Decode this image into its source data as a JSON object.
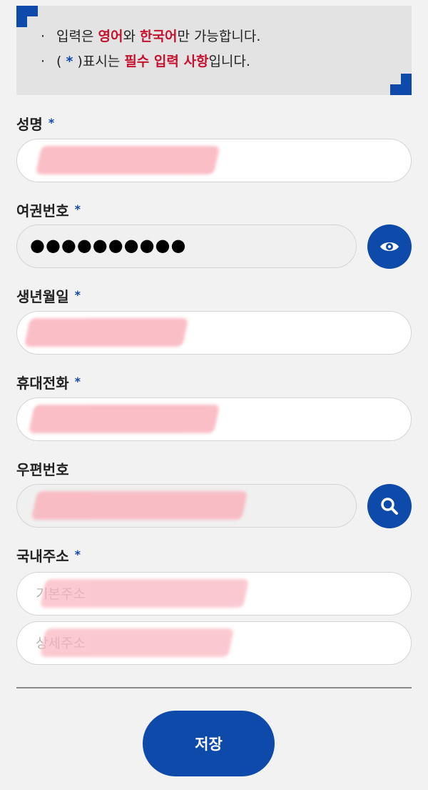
{
  "notice": {
    "bullet": "·",
    "line1": {
      "pre": "입력은 ",
      "hl1": "영어",
      "mid": "와 ",
      "hl2": "한국어",
      "post": "만 가능합니다."
    },
    "line2": {
      "open": "( ",
      "star": "*",
      "close": " )표시는 ",
      "hl": "필수 입력 사항",
      "post": "입니다."
    }
  },
  "required_mark": "*",
  "fields": {
    "name": {
      "label": "성명",
      "value": ""
    },
    "passport": {
      "label": "여권번호",
      "masked": "●●●●●●●●●●"
    },
    "birth": {
      "label": "생년월일",
      "value": ""
    },
    "phone": {
      "label": "휴대전화",
      "value": ""
    },
    "zipcode": {
      "label": "우편번호",
      "value": ""
    },
    "address": {
      "label": "국내주소",
      "basic_placeholder": "기본주소",
      "detail_placeholder": "상세주소"
    }
  },
  "buttons": {
    "save": "저장",
    "show_password_icon": "eye-icon",
    "search_icon": "search-icon"
  },
  "colors": {
    "primary": "#0e4aa9",
    "highlight": "#c4122f",
    "redaction": "#f9b3bd"
  }
}
